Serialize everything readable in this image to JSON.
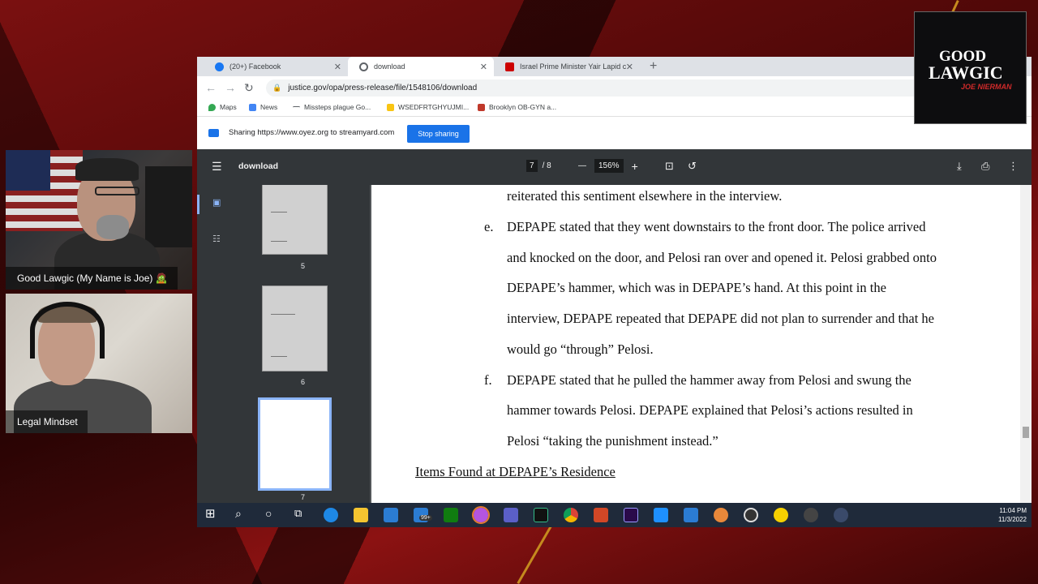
{
  "browser": {
    "tabs": [
      {
        "label": "(20+) Facebook",
        "favicon_color": "#1877f2"
      },
      {
        "label": "download",
        "favicon_color": "#5f6368"
      },
      {
        "label": "Israel Prime Minister Yair Lapid c",
        "favicon_color": "#cc0000"
      }
    ],
    "url": "justice.gov/opa/press-release/file/1548106/download",
    "bookmarks": [
      "Maps",
      "News",
      "Missteps plague Go...",
      "WSEDFRTGHYUJMI...",
      "Brooklyn OB-GYN a..."
    ]
  },
  "sharing": {
    "text": "Sharing https://www.oyez.org to streamyard.com",
    "stop_label": "Stop sharing"
  },
  "pdf": {
    "title": "download",
    "current_page": "7",
    "total_pages": "8",
    "zoom": "156%",
    "thumbnails": [
      "5",
      "6",
      "7"
    ],
    "content": {
      "intro_line": "reiterated this sentiment elsewhere in the interview.",
      "item_e_letter": "e.",
      "item_e_lines": [
        "DEPAPE stated that they went downstairs to the front door.  The police arrived",
        "and knocked on the door, and Pelosi ran over and opened it.  Pelosi grabbed onto",
        "DEPAPE’s hammer, which was in DEPAPE’s hand. At this point in the",
        "interview, DEPAPE repeated that DEPAPE did not plan to surrender and that he",
        "would go “through” Pelosi."
      ],
      "item_f_letter": "f.",
      "item_f_lines": [
        "DEPAPE stated that he pulled the hammer away from Pelosi and swung the",
        "hammer towards Pelosi.  DEPAPE explained that Pelosi’s actions resulted in",
        "Pelosi “taking the punishment instead.”"
      ],
      "section_heading": "Items Found at DEPAPE’s Residence"
    }
  },
  "taskbar": {
    "badge": "99+",
    "time": "11:04 PM",
    "date": "11/3/2022"
  },
  "cams": {
    "cam1_name": "Good Lawgic (My Name is Joe) 🧟",
    "cam2_name": "Legal Mindset"
  },
  "logo": {
    "line1": "GOOD",
    "line2": "LAWGIC",
    "line3": "JOE NIERMAN"
  }
}
